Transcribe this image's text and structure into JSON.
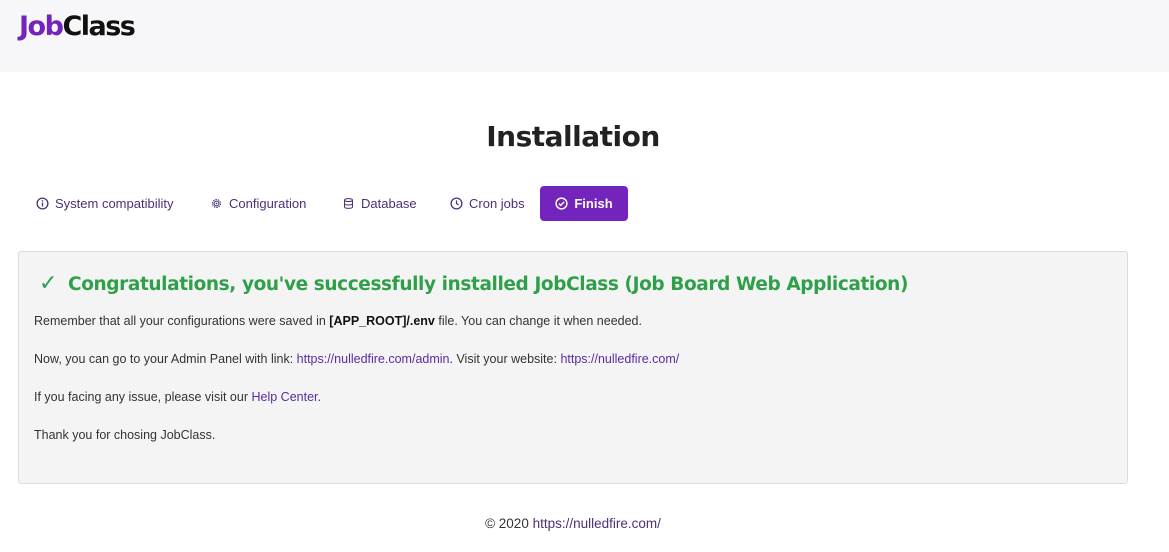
{
  "header": {
    "logo_part1": "Job",
    "logo_part2": "Class"
  },
  "page": {
    "title": "Installation"
  },
  "steps": [
    {
      "label": "System compatibility",
      "icon": "info-circle-icon",
      "active": false
    },
    {
      "label": "Configuration",
      "icon": "gear-icon",
      "active": false
    },
    {
      "label": "Database",
      "icon": "database-icon",
      "active": false
    },
    {
      "label": "Cron jobs",
      "icon": "clock-icon",
      "active": false
    },
    {
      "label": "Finish",
      "icon": "check-circle-icon",
      "active": true
    }
  ],
  "panel": {
    "check_icon": "✓",
    "congrats": "Congratulations, you've successfully installed JobClass (Job Board Web Application)",
    "line1_pre": "Remember that all your configurations were saved in ",
    "line1_bold": "[APP_ROOT]/.env",
    "line1_post": " file. You can change it when needed.",
    "line2_pre": "Now, you can go to your Admin Panel with link: ",
    "line2_link1": "https://nulledfire.com/admin",
    "line2_mid": ". Visit your website: ",
    "line2_link2": "https://nulledfire.com/",
    "line3_pre": "If you facing any issue, please visit our ",
    "line3_link": "Help Center",
    "line3_post": ".",
    "line4": "Thank you for chosing JobClass."
  },
  "footer": {
    "copyright": "© 2020 ",
    "link": "https://nulledfire.com/"
  },
  "colors": {
    "accent": "#7324bc",
    "success": "#2fa04a",
    "link": "#5b2ca0",
    "header_bg": "#f7f7f9",
    "panel_bg": "#f4f4f4"
  }
}
